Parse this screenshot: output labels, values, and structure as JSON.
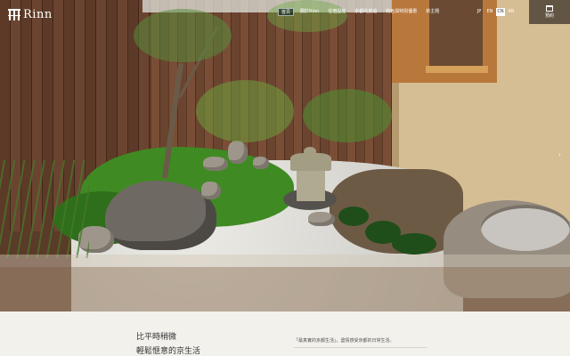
{
  "brand": {
    "logo_text": "Rinn"
  },
  "nav": {
    "items": [
      {
        "label": "首頁",
        "active": true
      },
      {
        "label": "關於Rinn",
        "active": false
      },
      {
        "label": "住宿設施",
        "active": false
      },
      {
        "label": "京都的旅遊",
        "active": false
      },
      {
        "label": "特色與特別優惠",
        "active": false
      },
      {
        "label": "新主題",
        "active": false
      }
    ]
  },
  "languages": [
    {
      "label": "JP",
      "active": false
    },
    {
      "label": "EN",
      "active": false
    },
    {
      "label": "CN",
      "active": true
    },
    {
      "label": "KR",
      "active": false
    }
  ],
  "reserve": {
    "label": "預約",
    "icon": "calendar-icon"
  },
  "hero": {
    "next_icon": "chevron-right-icon"
  },
  "intro": {
    "heading_line1": "比平時稍微",
    "heading_line2": "輕鬆愜意的京生活",
    "subtitle": "「最真實的京都生活」，盡情感受京都的日常生活。"
  },
  "colors": {
    "accent": "#1c3a2b",
    "wall": "#d6be94",
    "background": "#f3f1ec"
  }
}
